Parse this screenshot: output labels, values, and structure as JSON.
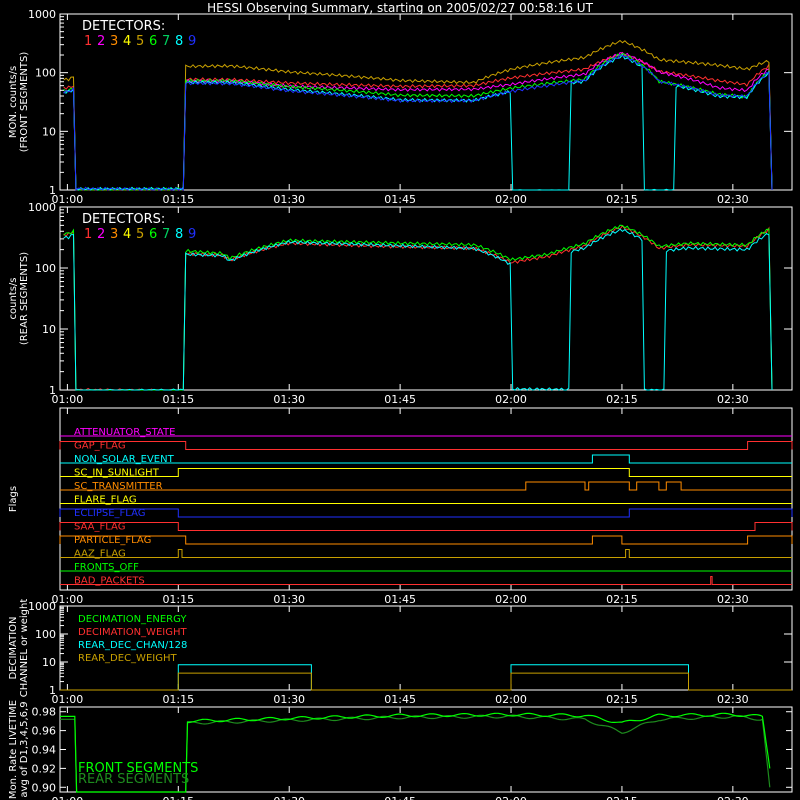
{
  "chart_data": {
    "title": "HESSI Observing Summary, starting on 2005/02/27 00:58:16 UT",
    "x_tick_labels": [
      "01:00",
      "01:15",
      "01:30",
      "01:45",
      "02:00",
      "02:15",
      "02:30"
    ],
    "x_tick_minutes": [
      0,
      15,
      30,
      45,
      60,
      75,
      90
    ],
    "xlim_minutes": [
      -1,
      98
    ],
    "colors": {
      "background": "#000000",
      "axes": "#ffffff",
      "det1": "#ff3030",
      "det2": "#ff00ff",
      "det3": "#ff8c00",
      "det4": "#ffff00",
      "det5": "#c8a000",
      "det6": "#00ff00",
      "det7": "#00d060",
      "det8": "#00ffff",
      "det9": "#2030ff"
    },
    "panels": [
      {
        "type": "line",
        "ylabel": [
          "MON. counts/s",
          "(FRONT SEGMENTS)"
        ],
        "y_scale": "log",
        "ylim": [
          1,
          1000
        ],
        "y_tick_labels": [
          "1",
          "10",
          "100",
          "1000"
        ],
        "legend_title": "DETECTORS:",
        "legend_numbers": [
          "1",
          "2",
          "3",
          "4",
          "5",
          "6",
          "7",
          "8",
          "9"
        ],
        "data_gaps_minutes": [
          [
            1,
            16
          ]
        ],
        "series_profile_minutes": [
          0,
          1,
          16,
          22,
          30,
          45,
          55,
          60,
          70,
          75,
          80,
          88,
          92,
          95
        ],
        "series": [
          {
            "name": "1",
            "values": [
              55,
              60,
              80,
              80,
              70,
              60,
              60,
              80,
              110,
              200,
              100,
              70,
              60,
              130
            ]
          },
          {
            "name": "2",
            "values": [
              50,
              55,
              75,
              75,
              60,
              50,
              50,
              60,
              90,
              210,
              100,
              55,
              50,
              120
            ]
          },
          {
            "name": "5",
            "values": [
              80,
              90,
              130,
              130,
              100,
              70,
              65,
              110,
              180,
              350,
              170,
              140,
              120,
              170
            ]
          },
          {
            "name": "6",
            "values": [
              50,
              55,
              70,
              70,
              55,
              40,
              40,
              55,
              80,
              220,
              75,
              45,
              40,
              110
            ]
          },
          {
            "name": "8",
            "values": [
              45,
              50,
              65,
              65,
              50,
              35,
              35,
              50,
              75,
              200,
              70,
              40,
              38,
              100
            ]
          },
          {
            "name": "9",
            "values": [
              45,
              50,
              65,
              65,
              50,
              35,
              35,
              50,
              75,
              200,
              70,
              40,
              38,
              100
            ]
          }
        ],
        "dropouts_minutes": [
          {
            "detector": "8",
            "from": 60,
            "to": 68
          },
          {
            "detector": "8",
            "from": 78,
            "to": 82
          }
        ]
      },
      {
        "type": "line",
        "ylabel": [
          "counts/s",
          "(REAR SEGMENTS)"
        ],
        "y_scale": "log",
        "ylim": [
          1,
          1000
        ],
        "y_tick_labels": [
          "1",
          "10",
          "100",
          "1000"
        ],
        "legend_title": "DETECTORS:",
        "legend_numbers": [
          "1",
          "2",
          "3",
          "4",
          "5",
          "6",
          "7",
          "8",
          "9"
        ],
        "data_gaps_minutes": [
          [
            1,
            16
          ]
        ],
        "series_profile_minutes": [
          0,
          1,
          16,
          21,
          22,
          30,
          33,
          45,
          55,
          60,
          65,
          70,
          75,
          80,
          84,
          92,
          95
        ],
        "series": [
          {
            "name": "1",
            "values": [
              350,
              400,
              180,
              170,
              140,
              270,
              260,
              230,
              210,
              120,
              150,
              220,
              450,
              200,
              230,
              220,
              420
            ]
          },
          {
            "name": "6",
            "values": [
              380,
              420,
              200,
              180,
              150,
              290,
              280,
              250,
              230,
              130,
              160,
              240,
              480,
              220,
              250,
              240,
              450
            ]
          },
          {
            "name": "8",
            "values": [
              330,
              380,
              170,
              160,
              130,
              260,
              250,
              220,
              200,
              110,
              140,
              210,
              430,
              190,
              220,
              210,
              400
            ]
          }
        ],
        "dropouts_minutes": [
          {
            "detector": "8",
            "from": 60,
            "to": 68
          },
          {
            "detector": "8",
            "from": 78,
            "to": 81
          }
        ]
      },
      {
        "type": "step",
        "ylabel": [
          "Flags"
        ],
        "flags": [
          {
            "name": "ATTENUATOR_STATE",
            "color": "#ff00ff",
            "on_intervals": []
          },
          {
            "name": "GAP_FLAG",
            "color": "#ff3030",
            "on_intervals": [
              [
                -1,
                16
              ],
              [
                92,
                98
              ]
            ]
          },
          {
            "name": "NON_SOLAR_EVENT",
            "color": "#00ffff",
            "on_intervals": [
              [
                71,
                76
              ]
            ]
          },
          {
            "name": "SC_IN_SUNLIGHT",
            "color": "#ffff00",
            "on_intervals": [
              [
                15,
                76
              ]
            ]
          },
          {
            "name": "SC_TRANSMITTER",
            "color": "#ff8c00",
            "on_intervals": [
              [
                62,
                70
              ],
              [
                70.5,
                76
              ],
              [
                77,
                80
              ],
              [
                81,
                83
              ]
            ]
          },
          {
            "name": "FLARE_FLAG",
            "color": "#ffff00",
            "on_intervals": []
          },
          {
            "name": "ECLIPSE_FLAG",
            "color": "#2030ff",
            "on_intervals": [
              [
                -1,
                15
              ],
              [
                76,
                98
              ]
            ]
          },
          {
            "name": "SAA_FLAG",
            "color": "#ff3030",
            "on_intervals": [
              [
                -1,
                15
              ],
              [
                93,
                98
              ]
            ]
          },
          {
            "name": "PARTICLE_FLAG",
            "color": "#ff8c00",
            "on_intervals": [
              [
                -1,
                16
              ],
              [
                71,
                75
              ],
              [
                92,
                98
              ]
            ]
          },
          {
            "name": "AAZ_FLAG",
            "color": "#c8a000",
            "on_intervals": [
              [
                15,
                15.5
              ],
              [
                75.5,
                76
              ]
            ]
          },
          {
            "name": "FRONTS_OFF",
            "color": "#00ff00",
            "on_intervals": []
          },
          {
            "name": "BAD_PACKETS",
            "color": "#ff3030",
            "on_intervals": [
              [
                87,
                87.2
              ]
            ]
          }
        ]
      },
      {
        "type": "step",
        "ylabel": [
          "DECIMATION",
          "CHANNEL or weight"
        ],
        "y_scale": "log",
        "ylim": [
          1,
          1000
        ],
        "y_tick_labels": [
          "1",
          "10",
          "100",
          "1000"
        ],
        "legend": [
          {
            "name": "DECIMATION_ENERGY",
            "color": "#00ff00"
          },
          {
            "name": "DECIMATION_WEIGHT",
            "color": "#ff3030"
          },
          {
            "name": "REAR_DEC_CHAN/128",
            "color": "#00ffff"
          },
          {
            "name": "REAR_DEC_WEIGHT",
            "color": "#c8a000"
          }
        ],
        "series": [
          {
            "name": "REAR_DEC_CHAN/128",
            "baseline": 1,
            "steps": [
              {
                "from": 15,
                "to": 33,
                "value": 8
              },
              {
                "from": 60,
                "to": 84,
                "value": 8
              }
            ]
          },
          {
            "name": "REAR_DEC_WEIGHT",
            "baseline": 1,
            "steps": [
              {
                "from": 15,
                "to": 33,
                "value": 4
              },
              {
                "from": 60,
                "to": 84,
                "value": 4
              }
            ]
          }
        ]
      },
      {
        "type": "line",
        "ylabel": [
          "Mon. Rate LIVETIME",
          "avg of D1,3,4,5,6,9"
        ],
        "ylim": [
          0.895,
          0.985
        ],
        "y_tick_labels": [
          "0.90",
          "0.92",
          "0.94",
          "0.96",
          "0.98"
        ],
        "y_tick_values": [
          0.9,
          0.92,
          0.94,
          0.96,
          0.98
        ],
        "legend": [
          {
            "name": "FRONT SEGMENTS",
            "color": "#00ff00"
          },
          {
            "name": "REAR SEGMENTS",
            "color": "#1e8c1e"
          }
        ],
        "series_profile_minutes": [
          -1,
          1,
          1.1,
          16,
          16.1,
          30,
          45,
          60,
          70,
          75,
          80,
          90,
          94,
          95
        ],
        "series": [
          {
            "name": "FRONT SEGMENTS",
            "values": [
              0.975,
              0.975,
              0.88,
              0.88,
              0.97,
              0.973,
              0.976,
              0.977,
              0.976,
              0.968,
              0.976,
              0.977,
              0.975,
              0.92
            ]
          },
          {
            "name": "REAR SEGMENTS",
            "values": [
              0.972,
              0.972,
              0.88,
              0.88,
              0.968,
              0.971,
              0.974,
              0.975,
              0.972,
              0.958,
              0.972,
              0.975,
              0.972,
              0.9
            ]
          }
        ]
      }
    ]
  }
}
